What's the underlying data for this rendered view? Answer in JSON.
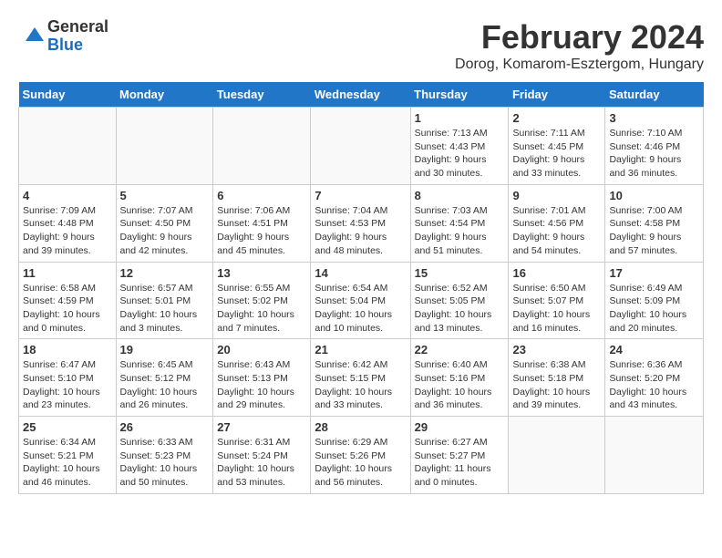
{
  "logo": {
    "general": "General",
    "blue": "Blue"
  },
  "title": "February 2024",
  "subtitle": "Dorog, Komarom-Esztergom, Hungary",
  "weekdays": [
    "Sunday",
    "Monday",
    "Tuesday",
    "Wednesday",
    "Thursday",
    "Friday",
    "Saturday"
  ],
  "weeks": [
    [
      {
        "day": "",
        "info": ""
      },
      {
        "day": "",
        "info": ""
      },
      {
        "day": "",
        "info": ""
      },
      {
        "day": "",
        "info": ""
      },
      {
        "day": "1",
        "info": "Sunrise: 7:13 AM\nSunset: 4:43 PM\nDaylight: 9 hours\nand 30 minutes."
      },
      {
        "day": "2",
        "info": "Sunrise: 7:11 AM\nSunset: 4:45 PM\nDaylight: 9 hours\nand 33 minutes."
      },
      {
        "day": "3",
        "info": "Sunrise: 7:10 AM\nSunset: 4:46 PM\nDaylight: 9 hours\nand 36 minutes."
      }
    ],
    [
      {
        "day": "4",
        "info": "Sunrise: 7:09 AM\nSunset: 4:48 PM\nDaylight: 9 hours\nand 39 minutes."
      },
      {
        "day": "5",
        "info": "Sunrise: 7:07 AM\nSunset: 4:50 PM\nDaylight: 9 hours\nand 42 minutes."
      },
      {
        "day": "6",
        "info": "Sunrise: 7:06 AM\nSunset: 4:51 PM\nDaylight: 9 hours\nand 45 minutes."
      },
      {
        "day": "7",
        "info": "Sunrise: 7:04 AM\nSunset: 4:53 PM\nDaylight: 9 hours\nand 48 minutes."
      },
      {
        "day": "8",
        "info": "Sunrise: 7:03 AM\nSunset: 4:54 PM\nDaylight: 9 hours\nand 51 minutes."
      },
      {
        "day": "9",
        "info": "Sunrise: 7:01 AM\nSunset: 4:56 PM\nDaylight: 9 hours\nand 54 minutes."
      },
      {
        "day": "10",
        "info": "Sunrise: 7:00 AM\nSunset: 4:58 PM\nDaylight: 9 hours\nand 57 minutes."
      }
    ],
    [
      {
        "day": "11",
        "info": "Sunrise: 6:58 AM\nSunset: 4:59 PM\nDaylight: 10 hours\nand 0 minutes."
      },
      {
        "day": "12",
        "info": "Sunrise: 6:57 AM\nSunset: 5:01 PM\nDaylight: 10 hours\nand 3 minutes."
      },
      {
        "day": "13",
        "info": "Sunrise: 6:55 AM\nSunset: 5:02 PM\nDaylight: 10 hours\nand 7 minutes."
      },
      {
        "day": "14",
        "info": "Sunrise: 6:54 AM\nSunset: 5:04 PM\nDaylight: 10 hours\nand 10 minutes."
      },
      {
        "day": "15",
        "info": "Sunrise: 6:52 AM\nSunset: 5:05 PM\nDaylight: 10 hours\nand 13 minutes."
      },
      {
        "day": "16",
        "info": "Sunrise: 6:50 AM\nSunset: 5:07 PM\nDaylight: 10 hours\nand 16 minutes."
      },
      {
        "day": "17",
        "info": "Sunrise: 6:49 AM\nSunset: 5:09 PM\nDaylight: 10 hours\nand 20 minutes."
      }
    ],
    [
      {
        "day": "18",
        "info": "Sunrise: 6:47 AM\nSunset: 5:10 PM\nDaylight: 10 hours\nand 23 minutes."
      },
      {
        "day": "19",
        "info": "Sunrise: 6:45 AM\nSunset: 5:12 PM\nDaylight: 10 hours\nand 26 minutes."
      },
      {
        "day": "20",
        "info": "Sunrise: 6:43 AM\nSunset: 5:13 PM\nDaylight: 10 hours\nand 29 minutes."
      },
      {
        "day": "21",
        "info": "Sunrise: 6:42 AM\nSunset: 5:15 PM\nDaylight: 10 hours\nand 33 minutes."
      },
      {
        "day": "22",
        "info": "Sunrise: 6:40 AM\nSunset: 5:16 PM\nDaylight: 10 hours\nand 36 minutes."
      },
      {
        "day": "23",
        "info": "Sunrise: 6:38 AM\nSunset: 5:18 PM\nDaylight: 10 hours\nand 39 minutes."
      },
      {
        "day": "24",
        "info": "Sunrise: 6:36 AM\nSunset: 5:20 PM\nDaylight: 10 hours\nand 43 minutes."
      }
    ],
    [
      {
        "day": "25",
        "info": "Sunrise: 6:34 AM\nSunset: 5:21 PM\nDaylight: 10 hours\nand 46 minutes."
      },
      {
        "day": "26",
        "info": "Sunrise: 6:33 AM\nSunset: 5:23 PM\nDaylight: 10 hours\nand 50 minutes."
      },
      {
        "day": "27",
        "info": "Sunrise: 6:31 AM\nSunset: 5:24 PM\nDaylight: 10 hours\nand 53 minutes."
      },
      {
        "day": "28",
        "info": "Sunrise: 6:29 AM\nSunset: 5:26 PM\nDaylight: 10 hours\nand 56 minutes."
      },
      {
        "day": "29",
        "info": "Sunrise: 6:27 AM\nSunset: 5:27 PM\nDaylight: 11 hours\nand 0 minutes."
      },
      {
        "day": "",
        "info": ""
      },
      {
        "day": "",
        "info": ""
      }
    ]
  ]
}
